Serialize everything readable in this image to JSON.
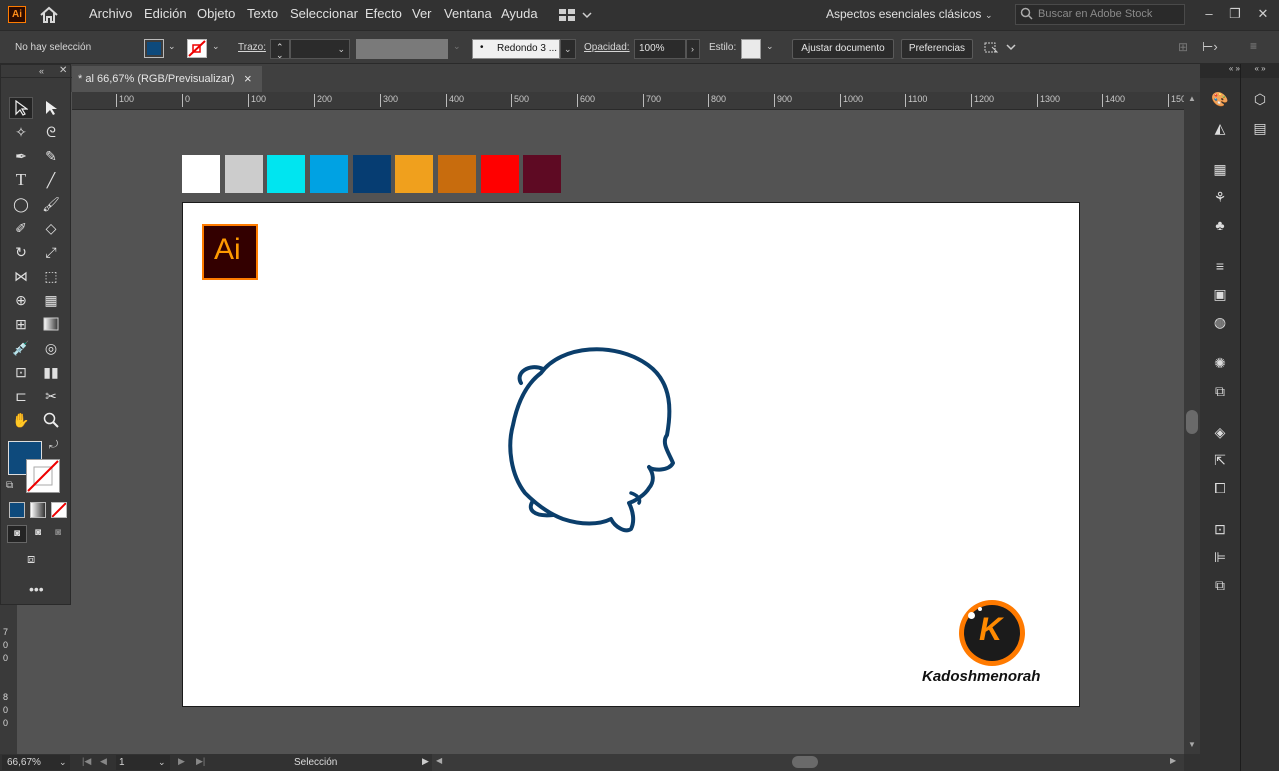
{
  "app": {
    "logo": "Ai"
  },
  "menu": [
    "Archivo",
    "Edición",
    "Objeto",
    "Texto",
    "Seleccionar",
    "Efecto",
    "Ver",
    "Ventana",
    "Ayuda"
  ],
  "workspace": {
    "label": "Aspectos esenciales clásicos"
  },
  "search": {
    "placeholder": "Buscar en Adobe Stock"
  },
  "control_bar": {
    "selection": "No hay selección",
    "stroke_label": "Trazo:",
    "brush_value": "Redondo 3 ...",
    "opacity_label": "Opacidad:",
    "opacity_value": "100%",
    "style_label": "Estilo:",
    "adjust_button": "Ajustar documento",
    "prefs_button": "Preferencias",
    "fill_color": "#0e4a7c"
  },
  "document_tab": {
    "title": "* al 66,67% (RGB/Previsualizar)",
    "close": "×"
  },
  "ruler": {
    "h_ticks": [
      "100",
      "0",
      "100",
      "200",
      "300",
      "400",
      "500",
      "600",
      "700",
      "800",
      "900",
      "1000",
      "1100",
      "1200",
      "1300",
      "1400",
      "150"
    ],
    "v_ticks": [
      "7",
      "0",
      "0",
      "8",
      "0",
      "0"
    ]
  },
  "swatches": [
    "#ffffff",
    "#cccccc",
    "#00e5f0",
    "#00a2e3",
    "#063d72",
    "#f0a01d",
    "#c86c0d",
    "#ff0000",
    "#5e0a23"
  ],
  "artboard": {
    "ai_badge": "Ai",
    "brand_logo_letter": "K",
    "brand_name": "Kadoshmenorah",
    "stroke_color": "#0b3e6b"
  },
  "status": {
    "zoom": "66,67%",
    "page": "1",
    "mode": "Selección"
  },
  "icons": {
    "home": "home-icon",
    "search": "search-icon"
  }
}
